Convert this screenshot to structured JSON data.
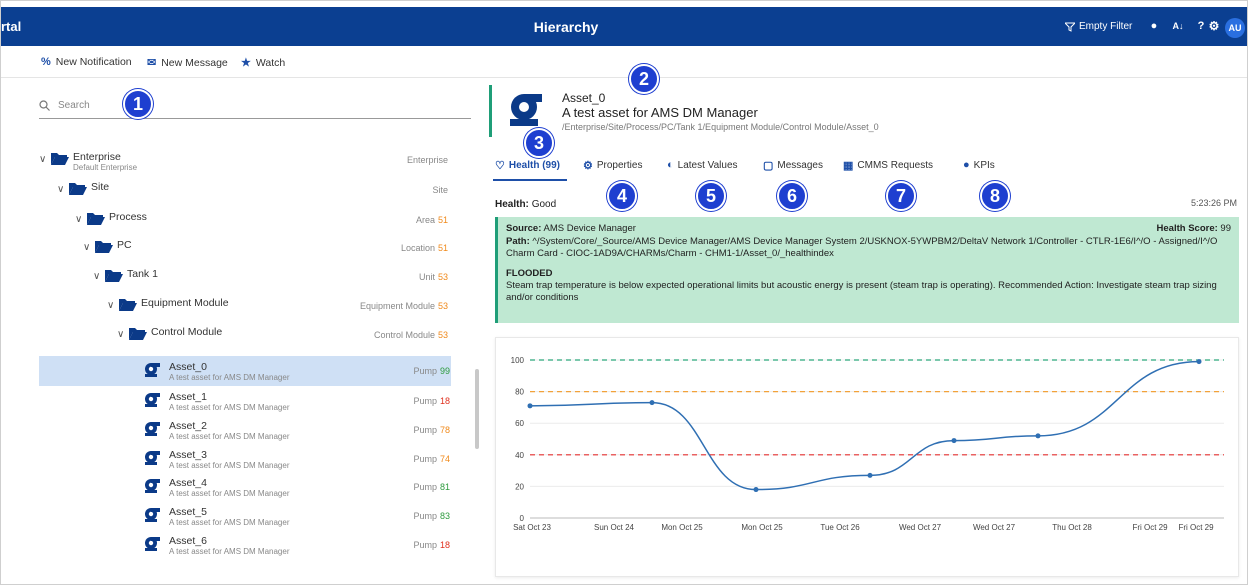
{
  "header": {
    "portal_text": "rtal",
    "title": "Hierarchy",
    "filter_label": "Empty Filter",
    "avatar_initials": "AU",
    "accent_color": "#0b3f91"
  },
  "actions": {
    "new_notification": "New Notification",
    "new_message": "New Message",
    "watch": "Watch"
  },
  "search": {
    "placeholder": "Search"
  },
  "tree": [
    {
      "name": "Enterprise",
      "sub": "Default Enterprise",
      "type": "Enterprise",
      "num": ""
    },
    {
      "name": "Site",
      "sub": "",
      "type": "Site",
      "num": ""
    },
    {
      "name": "Process",
      "sub": "",
      "type": "Area",
      "num": "51"
    },
    {
      "name": "PC",
      "sub": "",
      "type": "Location",
      "num": "51"
    },
    {
      "name": "Tank 1",
      "sub": "",
      "type": "Unit",
      "num": "53"
    },
    {
      "name": "Equipment Module",
      "sub": "",
      "type": "Equipment Module",
      "num": "53"
    },
    {
      "name": "Control Module",
      "sub": "",
      "type": "Control Module",
      "num": "53"
    }
  ],
  "assets": [
    {
      "name": "Asset_0",
      "desc": "A test asset for AMS DM Manager",
      "type": "Pump",
      "score": "99",
      "color": "#2e9b3e"
    },
    {
      "name": "Asset_1",
      "desc": "A test asset for AMS DM Manager",
      "type": "Pump",
      "score": "18",
      "color": "#e0301e"
    },
    {
      "name": "Asset_2",
      "desc": "A test asset for AMS DM Manager",
      "type": "Pump",
      "score": "78",
      "color": "#f08a1c"
    },
    {
      "name": "Asset_3",
      "desc": "A test asset for AMS DM Manager",
      "type": "Pump",
      "score": "74",
      "color": "#f08a1c"
    },
    {
      "name": "Asset_4",
      "desc": "A test asset for AMS DM Manager",
      "type": "Pump",
      "score": "81",
      "color": "#2e9b3e"
    },
    {
      "name": "Asset_5",
      "desc": "A test asset for AMS DM Manager",
      "type": "Pump",
      "score": "83",
      "color": "#2e9b3e"
    },
    {
      "name": "Asset_6",
      "desc": "A test asset for AMS DM Manager",
      "type": "Pump",
      "score": "18",
      "color": "#e0301e"
    }
  ],
  "asset_header": {
    "name": "Asset_0",
    "description": "A test asset for AMS DM Manager",
    "path": "/Enterprise/Site/Process/PC/Tank 1/Equipment Module/Control Module/Asset_0"
  },
  "tabs": {
    "health": "Health (99)",
    "properties": "Properties",
    "latest_values": "Latest Values",
    "messages": "Messages",
    "cmms": "CMMS Requests",
    "kpis": "KPIs"
  },
  "health": {
    "label": "Health:",
    "value": "Good",
    "time": "5:23:26 PM"
  },
  "notice": {
    "source_label": "Source:",
    "source_value": "AMS Device Manager",
    "score_label": "Health Score:",
    "score_value": "99",
    "path_label": "Path:",
    "path_value": "^/System/Core/_Source/AMS Device Manager/AMS Device Manager System 2/USKNOX-5YWPBM2/DeltaV Network 1/Controller - CTLR-1E6/I^/O - Assigned/I^/O Charm Card - CIOC-1AD9A/CHARMs/Charm - CHM1-1/Asset_0/_healthindex",
    "title": "FLOODED",
    "message": "Steam trap temperature is below expected operational limits but acoustic energy is present (steam trap is operating). Recommended Action: Investigate steam trap sizing and/or conditions"
  },
  "callouts": [
    "1",
    "2",
    "3",
    "4",
    "5",
    "6",
    "7",
    "8"
  ],
  "chart_data": {
    "type": "line",
    "title": "",
    "xlabel": "",
    "ylabel": "",
    "categories": [
      "Sat Oct 23",
      "Sun Oct 24",
      "Mon Oct 25",
      "Mon Oct 25",
      "Tue Oct 26",
      "Wed Oct 27",
      "Wed Oct 27",
      "Thu Oct 28",
      "Fri Oct 29",
      "Fri Oct 29"
    ],
    "series": [
      {
        "values": [
          null,
          71,
          73,
          18,
          27,
          49,
          52,
          99
        ],
        "color": "#2f6fb3"
      }
    ],
    "points": [
      {
        "x": "Sat Oct 23",
        "y": 71
      },
      {
        "x": "Sun Oct 24",
        "y": 73
      },
      {
        "x": "Mon Oct 25",
        "y": 18
      },
      {
        "x": "Tue Oct 26",
        "y": 27
      },
      {
        "x": "Wed Oct 27",
        "y": 49
      },
      {
        "x": "Thu Oct 28",
        "y": 52
      },
      {
        "x": "Fri Oct 29",
        "y": 99
      }
    ],
    "thresholds": [
      {
        "value": 100,
        "color": "#2aa77a"
      },
      {
        "value": 80,
        "color": "#f2a23a"
      },
      {
        "value": 40,
        "color": "#e53030"
      }
    ],
    "yticks": [
      "0",
      "20",
      "40",
      "60",
      "80",
      "100"
    ],
    "ylim": [
      0,
      100
    ],
    "grid": true
  }
}
